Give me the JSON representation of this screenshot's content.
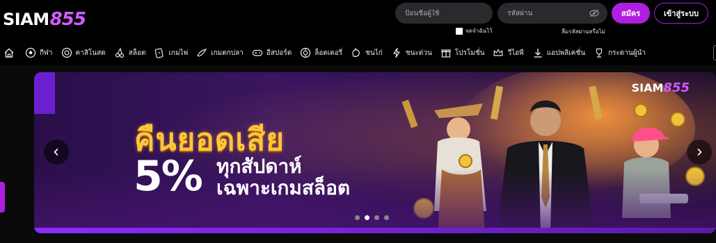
{
  "brand": {
    "logo_text_a": "SIAM",
    "logo_text_b": "855"
  },
  "login": {
    "username_placeholder": "ป้อนชื่อผู้ใช้",
    "password_placeholder": "รหัสผ่าน",
    "remember_label": "จดจำฉันไว้",
    "forgot_label": "ลืมรหัสผ่านหรือไม่",
    "signup_label": "สมัคร",
    "login_label": "เข้าสู่ระบบ"
  },
  "nav": {
    "items": [
      {
        "label": "กีฬา",
        "icon": "soccer-ball-icon"
      },
      {
        "label": "คาสิโนสด",
        "icon": "casino-chip-icon"
      },
      {
        "label": "สล็อต",
        "icon": "cherries-icon"
      },
      {
        "label": "เกมไพ่",
        "icon": "cards-icon"
      },
      {
        "label": "เกมตกปลา",
        "icon": "fishing-icon"
      },
      {
        "label": "อีสปอร์ต",
        "icon": "gamepad-icon"
      },
      {
        "label": "ล็อตเตอรี่",
        "icon": "lottery-ball-icon"
      },
      {
        "label": "ชนไก่",
        "icon": "rooster-icon"
      },
      {
        "label": "ชนะด่วน",
        "icon": "lightning-icon"
      },
      {
        "label": "โปรโมชั่น",
        "icon": "gift-icon"
      },
      {
        "label": "วีไอพี",
        "icon": "crown-icon"
      },
      {
        "label": "แอปพลิเคชั่น",
        "icon": "download-icon"
      },
      {
        "label": "กระดานผู้นำ",
        "icon": "trophy-icon"
      }
    ]
  },
  "banner": {
    "headline": "คืนยอดเสีย",
    "percent": "5%",
    "sub_line1": "ทุกสัปดาห์",
    "sub_line2": "เฉพาะเกมสล็อต",
    "logo_a": "SIAM",
    "logo_b": "855",
    "prev_icon": "chevron-left-icon",
    "next_icon": "chevron-right-icon",
    "slide_count": 4,
    "active_slide": 2
  },
  "colors": {
    "accent": "#b01ee0",
    "gold": "#ffc63a",
    "background": "#000000"
  }
}
